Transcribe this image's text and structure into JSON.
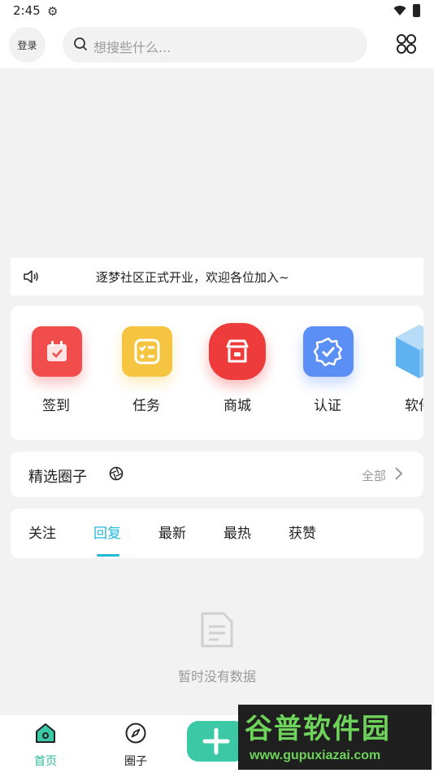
{
  "status_bar": {
    "time": "2:45"
  },
  "header": {
    "login_label": "登录",
    "search_placeholder": "想搜些什么..."
  },
  "notice": {
    "text": "逐梦社区正式开业，欢迎各位加入~"
  },
  "shortcuts": [
    {
      "label": "签到",
      "icon": "calendar-icon",
      "color": "#f24d4d"
    },
    {
      "label": "任务",
      "icon": "task-list-icon",
      "color": "#f5c542"
    },
    {
      "label": "商城",
      "icon": "shop-icon",
      "color": "#ee3b3b"
    },
    {
      "label": "认证",
      "icon": "verified-badge-icon",
      "color": "#5b8ff5"
    },
    {
      "label": "软件",
      "icon": "cube-icon",
      "color": "#5fb2f0"
    }
  ],
  "featured": {
    "title": "精选圈子",
    "all_label": "全部"
  },
  "tabs": [
    {
      "label": "关注",
      "active": false
    },
    {
      "label": "回复",
      "active": true
    },
    {
      "label": "最新",
      "active": false
    },
    {
      "label": "最热",
      "active": false
    },
    {
      "label": "获赞",
      "active": false
    }
  ],
  "empty_state": {
    "text": "暂时没有数据"
  },
  "bottom_nav": {
    "home": "首页",
    "circle": "圈子"
  },
  "watermark": {
    "title": "谷普软件园",
    "url": "www.gupuxiazai.com"
  },
  "colors": {
    "accent": "#22b8d8",
    "nav_active": "#2ab99a",
    "add_button": "#3ac8a5"
  }
}
